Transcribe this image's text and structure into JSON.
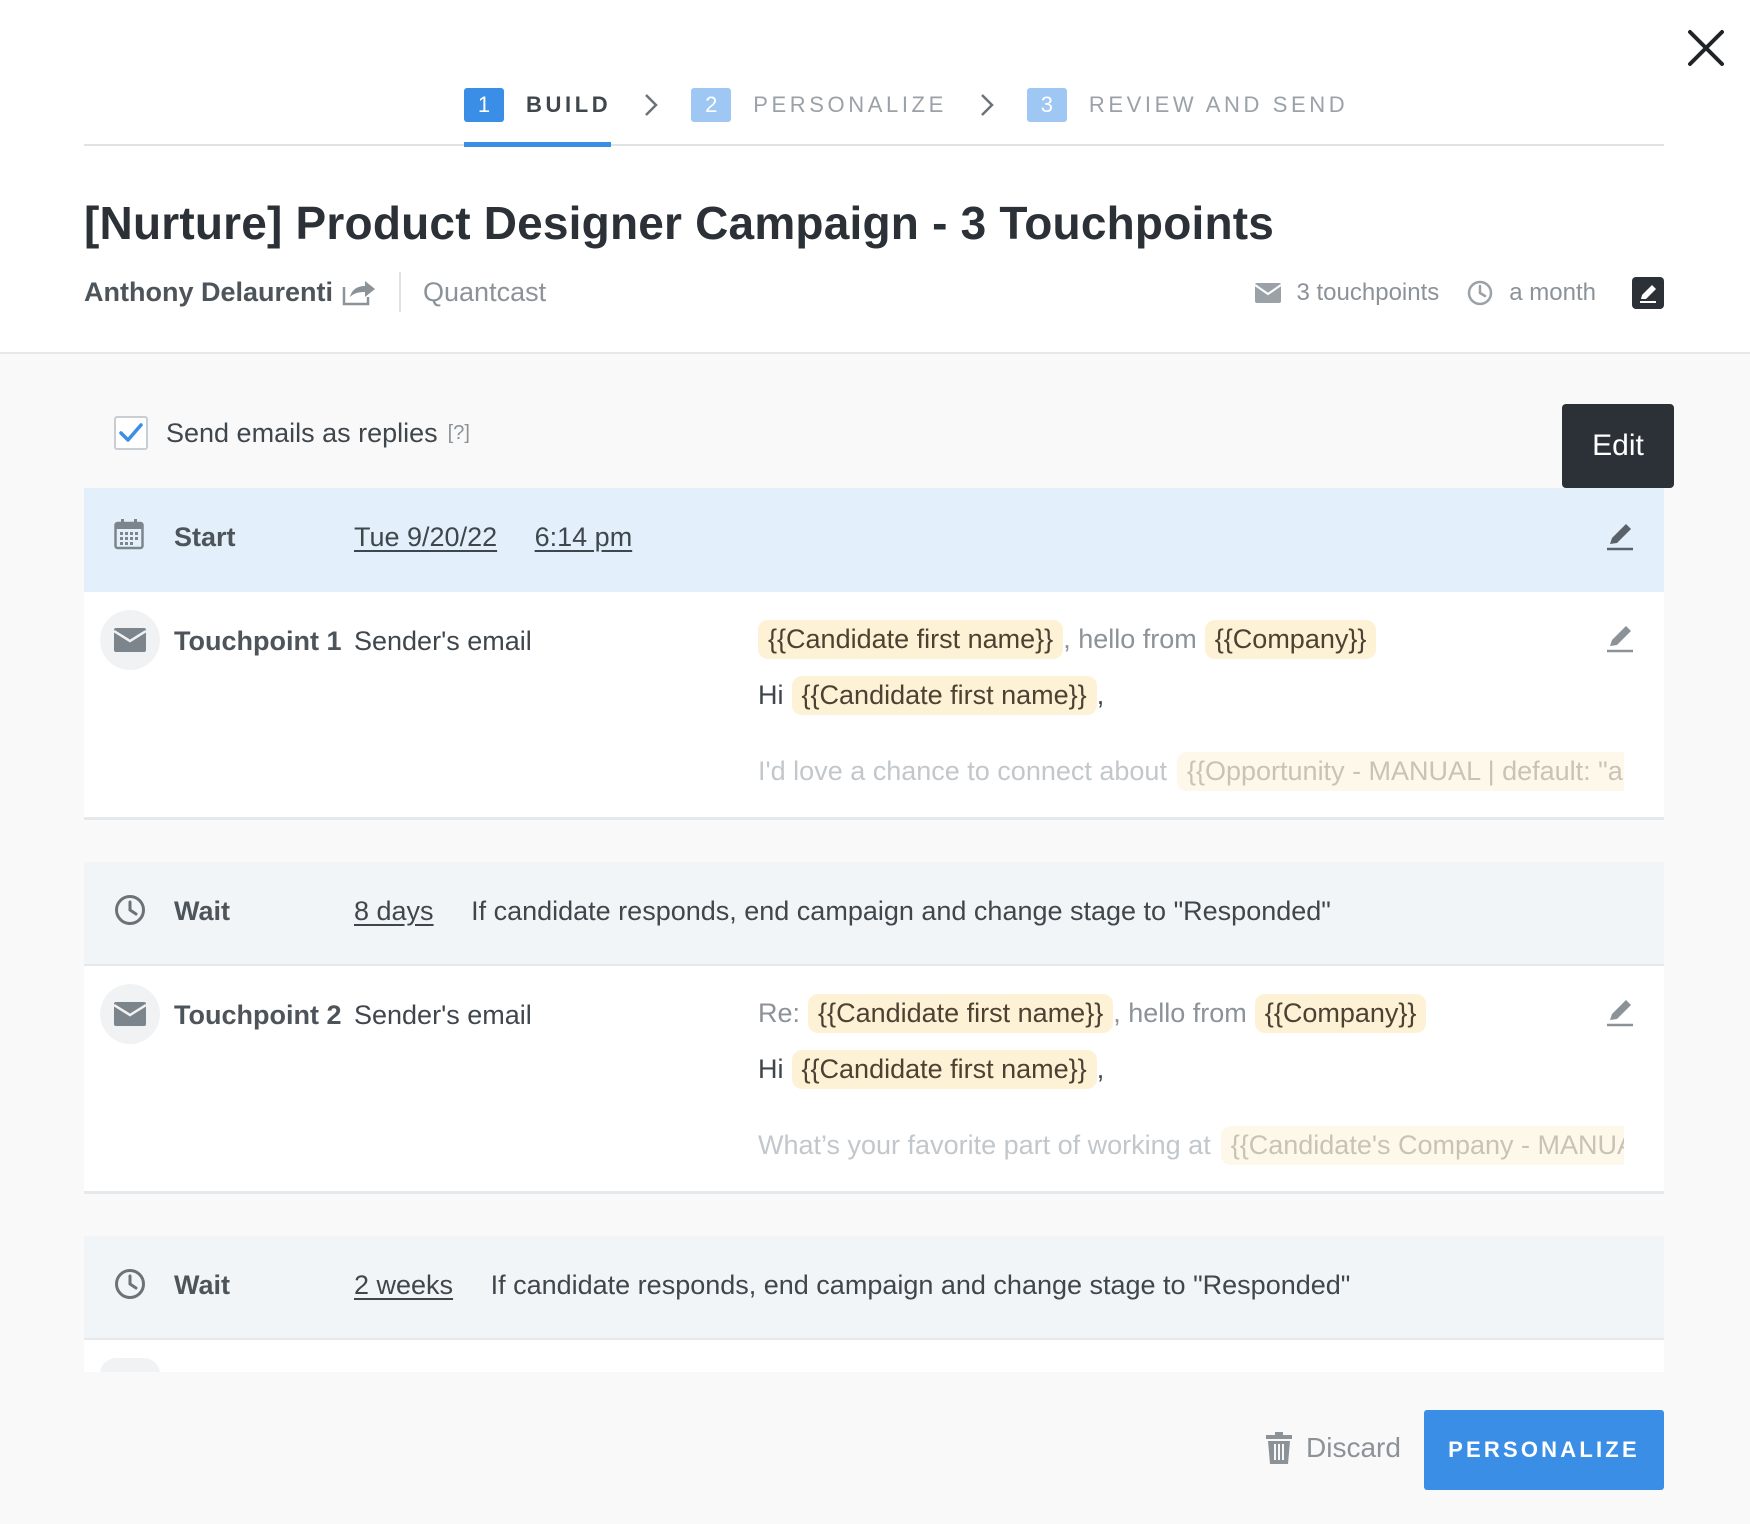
{
  "stepper": {
    "steps": [
      {
        "num": "1",
        "label": "BUILD"
      },
      {
        "num": "2",
        "label": "PERSONALIZE"
      },
      {
        "num": "3",
        "label": "REVIEW AND SEND"
      }
    ],
    "active_step": 1
  },
  "header": {
    "title": "[Nurture] Product Designer Campaign - 3 Touchpoints",
    "owner": "Anthony Delaurenti",
    "company": "Quantcast",
    "touchpoints_stat": "3 touchpoints",
    "duration_stat": "a month"
  },
  "options": {
    "send_as_replies_label": "Send emails as replies",
    "send_as_replies_checked": true,
    "help": "[?]"
  },
  "tooltip": {
    "text": "Edit"
  },
  "start": {
    "label": "Start",
    "date": "Tue 9/20/22",
    "time": "6:14 pm"
  },
  "touchpoint1": {
    "label": "Touchpoint 1",
    "sender": "Sender's email",
    "subject_token1": "{{Candidate first name}}",
    "subject_text": ", hello from",
    "subject_token2": "{{Company}}",
    "greeting": "Hi",
    "greeting_token": "{{Candidate first name}}",
    "greeting_comma": ",",
    "preview_text": "I'd love a chance to connect about",
    "preview_token": "{{Opportunity - MANUAL | default: \"an"
  },
  "wait1": {
    "label": "Wait",
    "duration": "8 days",
    "rule": "If candidate responds, end campaign and change stage to \"Responded\""
  },
  "touchpoint2": {
    "label": "Touchpoint 2",
    "sender": "Sender's email",
    "subject_prefix": "Re:",
    "subject_token1": "{{Candidate first name}}",
    "subject_text": ", hello from",
    "subject_token2": "{{Company}}",
    "greeting": "Hi",
    "greeting_token": "{{Candidate first name}}",
    "greeting_comma": ",",
    "preview_text": "What’s your favorite part of working at",
    "preview_token": "{{Candidate's Company - MANUAL}}",
    "preview_end": "?"
  },
  "wait2": {
    "label": "Wait",
    "duration": "2 weeks",
    "rule": "If candidate responds, end campaign and change stage to \"Responded\""
  },
  "footer": {
    "discard_label": "Discard",
    "primary_label": "PERSONALIZE"
  },
  "colors": {
    "accent": "#3a8ee6",
    "token_bg": "#fdf1d6",
    "start_row_bg": "#e3f0fb"
  }
}
